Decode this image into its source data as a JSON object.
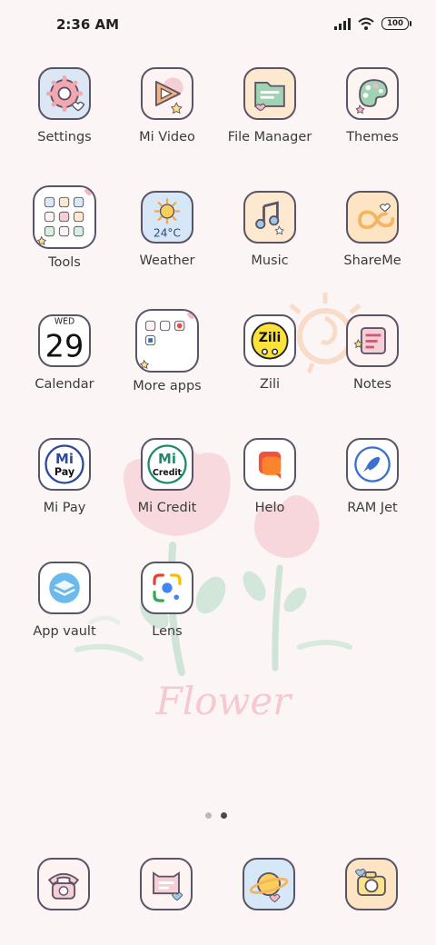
{
  "status_bar": {
    "time": "2:36 AM",
    "battery": "100",
    "icons": [
      "signal-icon",
      "wifi-icon",
      "battery-icon"
    ]
  },
  "wallpaper": {
    "text": "Flower"
  },
  "apps": [
    {
      "name": "Settings",
      "icon": "settings-icon"
    },
    {
      "name": "Mi Video",
      "icon": "video-icon"
    },
    {
      "name": "File Manager",
      "icon": "folder-icon"
    },
    {
      "name": "Themes",
      "icon": "palette-icon"
    },
    {
      "name": "Tools",
      "icon": "tools-folder-icon"
    },
    {
      "name": "Weather",
      "icon": "weather-icon",
      "temp": "24°C"
    },
    {
      "name": "Music",
      "icon": "music-icon"
    },
    {
      "name": "ShareMe",
      "icon": "shareme-icon"
    },
    {
      "name": "Calendar",
      "icon": "calendar-icon",
      "day": "WED",
      "date": "29"
    },
    {
      "name": "More apps",
      "icon": "more-apps-folder-icon"
    },
    {
      "name": "Zili",
      "icon": "zili-icon",
      "badge_text": "Zili"
    },
    {
      "name": "Notes",
      "icon": "notes-icon"
    },
    {
      "name": "Mi Pay",
      "icon": "mi-pay-icon",
      "line1": "Mi",
      "line2": "Pay"
    },
    {
      "name": "Mi Credit",
      "icon": "mi-credit-icon",
      "line1": "Mi",
      "line2": "Credit"
    },
    {
      "name": "Helo",
      "icon": "helo-icon"
    },
    {
      "name": "RAM Jet",
      "icon": "rocket-icon"
    },
    {
      "name": "App vault",
      "icon": "app-vault-icon"
    },
    {
      "name": "Lens",
      "icon": "lens-icon"
    }
  ],
  "page_indicator": {
    "pages": 2,
    "current": 2
  },
  "dock": [
    {
      "icon": "phone-icon"
    },
    {
      "icon": "messages-icon"
    },
    {
      "icon": "browser-icon"
    },
    {
      "icon": "camera-icon"
    }
  ],
  "colors": {
    "background": "#fbf5f6",
    "icon_border": "#5b5466",
    "accent_pink": "#f2a7b3"
  }
}
